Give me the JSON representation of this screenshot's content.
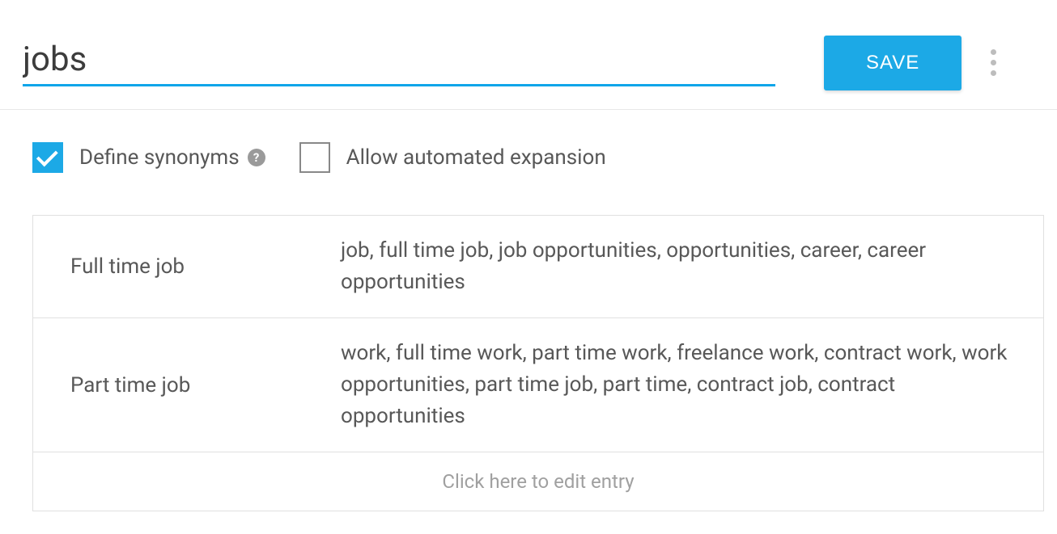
{
  "header": {
    "title_value": "jobs",
    "save_label": "SAVE"
  },
  "options": {
    "define_synonyms": {
      "label": "Define synonyms",
      "checked": true
    },
    "allow_automated_expansion": {
      "label": "Allow automated expansion",
      "checked": false
    }
  },
  "entries": [
    {
      "key": "Full time job",
      "synonyms": "job, full time job, job opportunities, opportunities, career, career opportunities"
    },
    {
      "key": "Part time job",
      "synonyms": "work, full time work, part time work, freelance work, contract work, work opportunities, part time job, part time, contract job, contract opportunities"
    }
  ],
  "edit_placeholder": "Click here to edit entry"
}
